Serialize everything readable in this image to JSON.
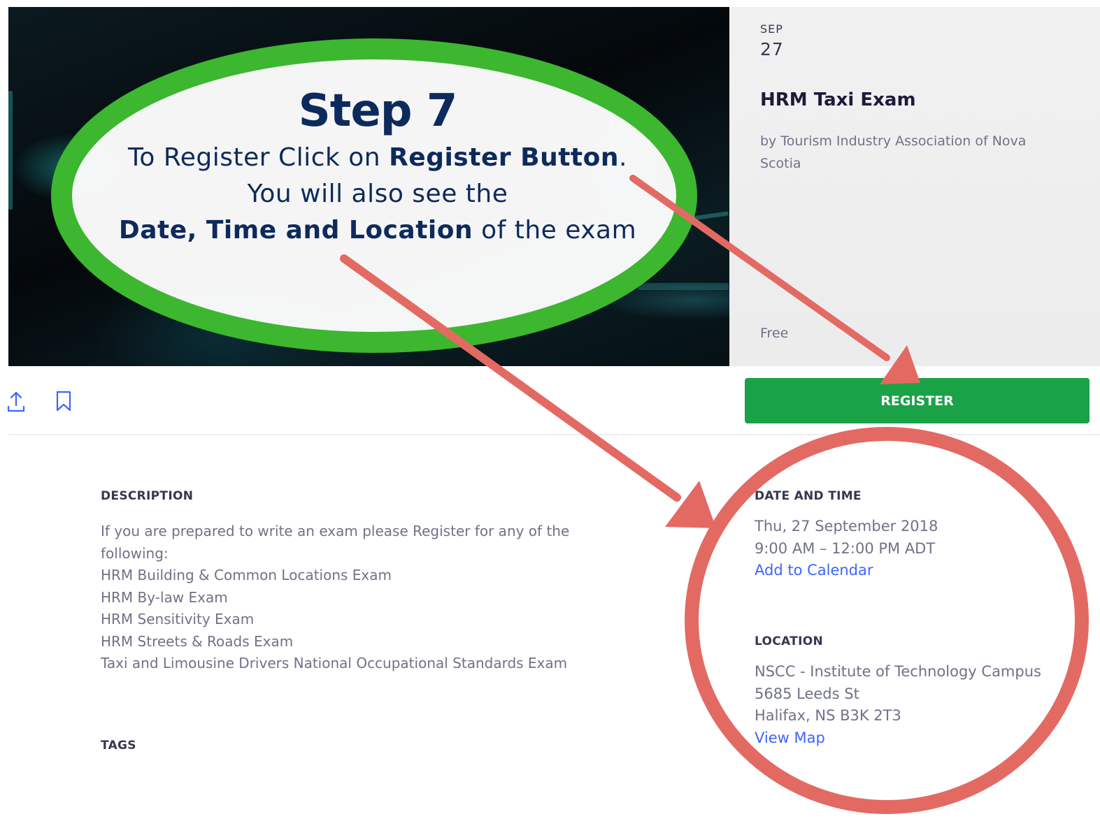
{
  "event": {
    "month": "SEP",
    "day": "27",
    "title": "HRM Taxi Exam",
    "organizer": "by Tourism Industry Association of Nova Scotia",
    "price": "Free"
  },
  "toolbar": {
    "register_label": "REGISTER",
    "share_icon": "share-icon",
    "bookmark_icon": "bookmark-icon"
  },
  "description": {
    "heading": "DESCRIPTION",
    "intro": "If you are prepared to write an exam please Register for any of the following:",
    "items": [
      "HRM Building & Common Locations Exam",
      "HRM By-law Exam",
      "HRM Sensitivity Exam",
      "HRM Streets & Roads Exam",
      "Taxi and Limousine Drivers National Occupational Standards Exam"
    ]
  },
  "tags": {
    "heading": "TAGS"
  },
  "date_time": {
    "heading": "DATE AND TIME",
    "date": "Thu, 27 September 2018",
    "time": "9:00 AM – 12:00 PM ADT",
    "add_to_calendar": "Add to Calendar"
  },
  "location": {
    "heading": "LOCATION",
    "venue": "NSCC - Institute of Technology Campus",
    "street": "5685 Leeds St",
    "city": "Halifax, NS B3K 2T3",
    "view_map": "View Map"
  },
  "annotation": {
    "step": "Step 7",
    "line1_pre": "To Register Click on ",
    "line1_bold": "Register Button",
    "line1_post": ".",
    "line2": "You will also see the",
    "line3_bold": "Date, Time and Location",
    "line3_post": " of the exam",
    "colors": {
      "ellipse_outline": "#3cb72f",
      "arrow": "#e36a62",
      "text": "#0d2a5c"
    }
  }
}
